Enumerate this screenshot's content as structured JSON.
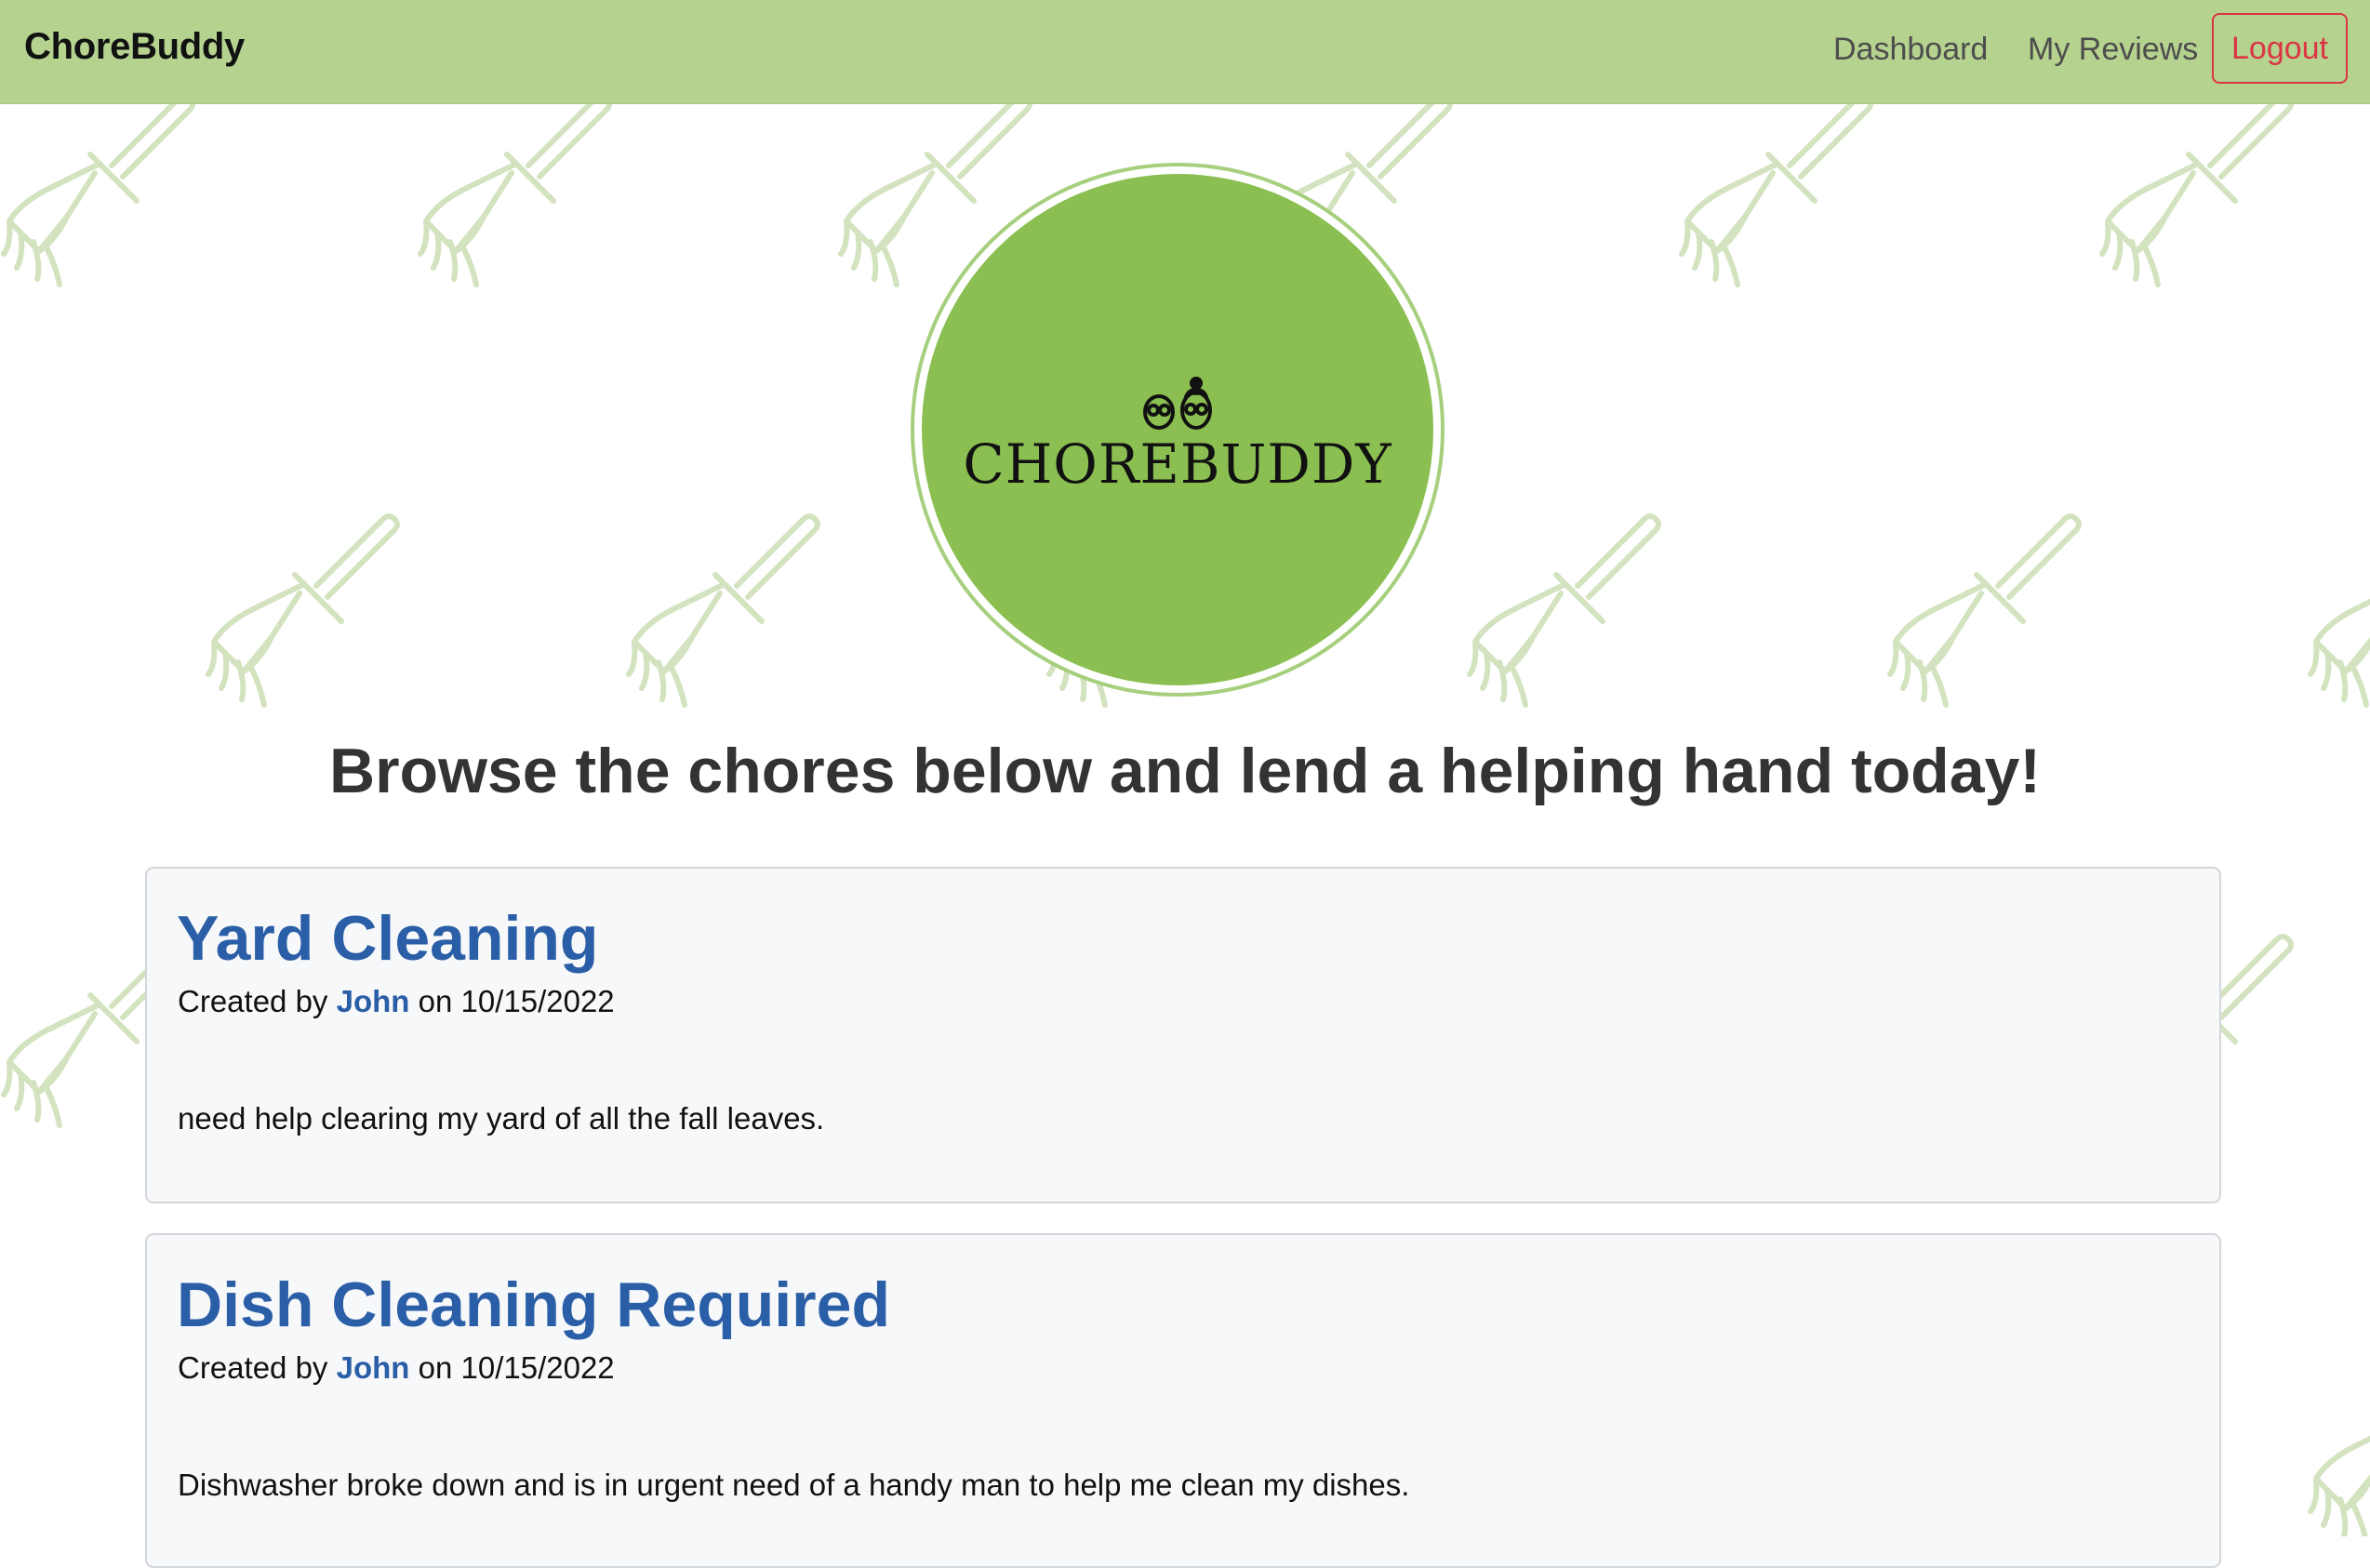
{
  "navbar": {
    "brand": "ChoreBuddy",
    "links": {
      "dashboard": "Dashboard",
      "my_reviews": "My Reviews",
      "logout": "Logout"
    }
  },
  "logo": {
    "text": "CHOREBUDDY",
    "icon": "two-faces-icon"
  },
  "headline": "Browse the chores below and lend a helping hand today!",
  "chores": [
    {
      "title": "Yard Cleaning",
      "created_prefix": "Created by",
      "author": "John",
      "date_prefix": "on",
      "date": "10/15/2022",
      "description": "need help clearing my yard of all the fall leaves."
    },
    {
      "title": "Dish Cleaning Required",
      "created_prefix": "Created by",
      "author": "John",
      "date_prefix": "on",
      "date": "10/15/2022",
      "description": "Dishwasher broke down and is in urgent need of a handy man to help me clean my dishes."
    }
  ],
  "colors": {
    "navbar_bg": "#b5d38f",
    "accent_blue": "#2a5ea6",
    "logout_red": "#dc3545",
    "logo_green": "#8bbf52",
    "pattern_green": "#cfe0b8"
  },
  "background_pattern_icon": "broom-icon"
}
